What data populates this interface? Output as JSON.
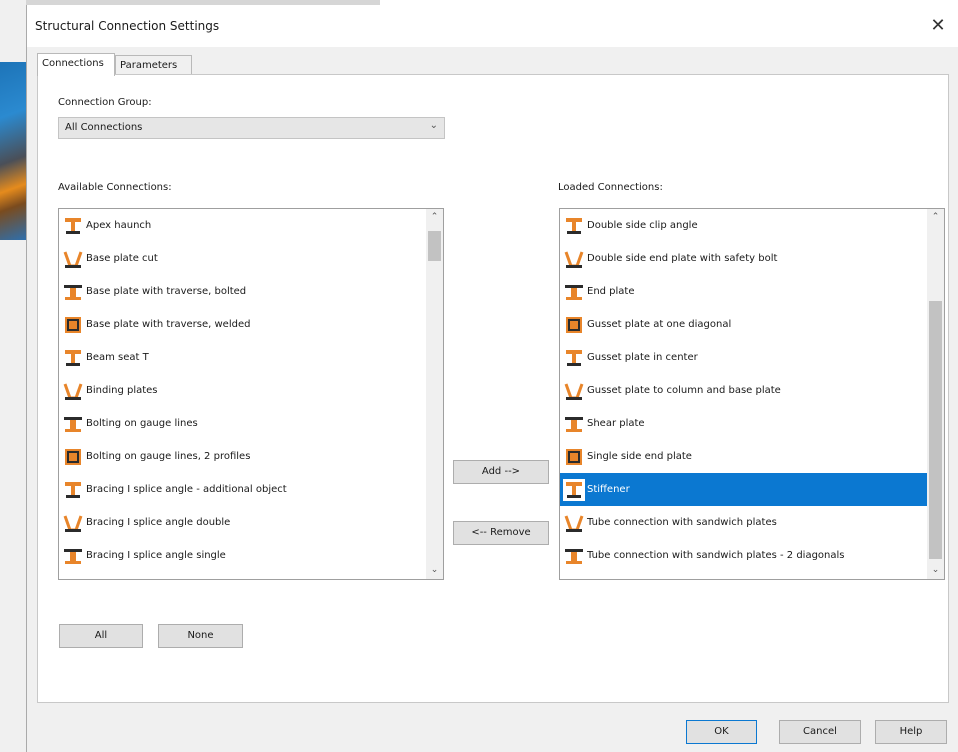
{
  "window": {
    "title": "Structural Connection Settings",
    "close_glyph": "✕"
  },
  "tabs": [
    {
      "label": "Connections"
    },
    {
      "label": "Parameters"
    }
  ],
  "connection_group": {
    "label": "Connection Group:",
    "value": "All Connections"
  },
  "available": {
    "label": "Available Connections:",
    "items": [
      {
        "label": "Apex haunch",
        "icon": "apex-haunch-icon"
      },
      {
        "label": "Base plate cut",
        "icon": "base-plate-cut-icon"
      },
      {
        "label": "Base plate with traverse, bolted",
        "icon": "base-plate-traverse-bolted-icon"
      },
      {
        "label": "Base plate with traverse, welded",
        "icon": "base-plate-traverse-welded-icon"
      },
      {
        "label": "Beam seat T",
        "icon": "beam-seat-t-icon"
      },
      {
        "label": "Binding plates",
        "icon": "binding-plates-icon"
      },
      {
        "label": "Bolting on gauge lines",
        "icon": "bolting-gauge-lines-icon"
      },
      {
        "label": "Bolting on gauge lines, 2 profiles",
        "icon": "bolting-gauge-lines-2-profiles-icon"
      },
      {
        "label": "Bracing I splice angle - additional object",
        "icon": "bracing-splice-angle-additional-icon"
      },
      {
        "label": "Bracing I splice angle double",
        "icon": "bracing-splice-angle-double-icon"
      },
      {
        "label": "Bracing I splice angle single",
        "icon": "bracing-splice-angle-single-icon"
      }
    ]
  },
  "loaded": {
    "label": "Loaded Connections:",
    "items": [
      {
        "label": "Double side clip angle",
        "icon": "double-side-clip-angle-icon",
        "selected": false
      },
      {
        "label": "Double side end plate with safety bolt",
        "icon": "double-side-end-plate-icon",
        "selected": false
      },
      {
        "label": "End plate",
        "icon": "end-plate-icon",
        "selected": false
      },
      {
        "label": "Gusset plate at one diagonal",
        "icon": "gusset-plate-diagonal-icon",
        "selected": false
      },
      {
        "label": "Gusset plate in center",
        "icon": "gusset-plate-center-icon",
        "selected": false
      },
      {
        "label": "Gusset plate to column and base plate",
        "icon": "gusset-plate-column-icon",
        "selected": false
      },
      {
        "label": "Shear plate",
        "icon": "shear-plate-icon",
        "selected": false
      },
      {
        "label": "Single side end plate",
        "icon": "single-side-end-plate-icon",
        "selected": false
      },
      {
        "label": "Stiffener",
        "icon": "stiffener-icon",
        "selected": true
      },
      {
        "label": "Tube connection with sandwich plates",
        "icon": "tube-sandwich-plates-icon",
        "selected": false
      },
      {
        "label": "Tube connection with sandwich plates - 2 diagonals",
        "icon": "tube-sandwich-plates-2-diagonals-icon",
        "selected": false
      }
    ]
  },
  "buttons": {
    "add": "Add -->",
    "remove": "<-- Remove",
    "all": "All",
    "none": "None",
    "ok": "OK",
    "cancel": "Cancel",
    "help": "Help"
  },
  "colors": {
    "selection": "#0b78d1",
    "icon_orange": "#e8852a",
    "icon_dark": "#2b2b2b"
  }
}
